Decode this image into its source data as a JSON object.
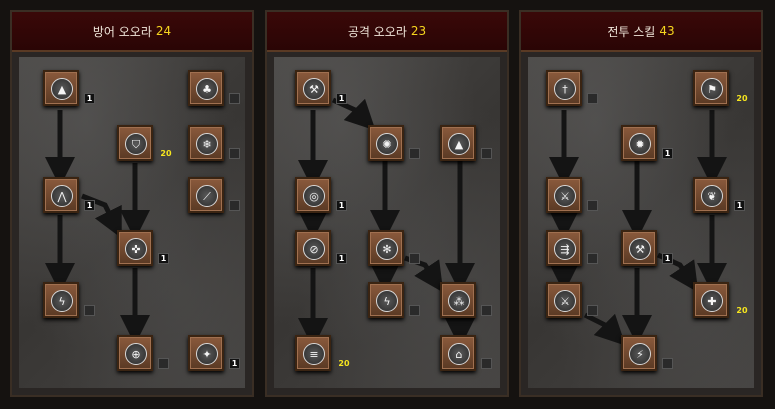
{
  "trees": [
    {
      "title": "방어 오오라",
      "points": "24"
    },
    {
      "title": "공격 오오라",
      "points": "23"
    },
    {
      "title": "전투 스킬",
      "points": "43"
    }
  ],
  "skills": {
    "t1": [
      {
        "icon": "mountain-icon",
        "glyph": "▲",
        "level": "1"
      },
      {
        "icon": "tree-icon",
        "glyph": "♣",
        "level": ""
      },
      {
        "icon": "shield-icon",
        "glyph": "⛉",
        "level": "20"
      },
      {
        "icon": "snowflake-icon",
        "glyph": "❄",
        "level": ""
      },
      {
        "icon": "spike-icon",
        "glyph": "⋀",
        "level": "1"
      },
      {
        "icon": "claw-icon",
        "glyph": "⟋",
        "level": ""
      },
      {
        "icon": "heal-icon",
        "glyph": "✜",
        "level": "1"
      },
      {
        "icon": "lightning-icon",
        "glyph": "ϟ",
        "level": ""
      },
      {
        "icon": "compass-icon",
        "glyph": "⊕",
        "level": ""
      },
      {
        "icon": "star-icon",
        "glyph": "✦",
        "level": "1"
      }
    ],
    "t2": [
      {
        "icon": "axe-icon",
        "glyph": "⚒",
        "level": "1"
      },
      {
        "icon": "burst-icon",
        "glyph": "✺",
        "level": ""
      },
      {
        "icon": "bell-icon",
        "glyph": "▲",
        "level": ""
      },
      {
        "icon": "target-icon",
        "glyph": "◎",
        "level": "1"
      },
      {
        "icon": "slash-icon",
        "glyph": "⊘",
        "level": "1"
      },
      {
        "icon": "wheel-icon",
        "glyph": "✻",
        "level": ""
      },
      {
        "icon": "lightning-icon",
        "glyph": "ϟ",
        "level": ""
      },
      {
        "icon": "trinity-icon",
        "glyph": "⁂",
        "level": ""
      },
      {
        "icon": "stripes-icon",
        "glyph": "≡",
        "level": "20"
      },
      {
        "icon": "tooth-icon",
        "glyph": "⌂",
        "level": ""
      }
    ],
    "t3": [
      {
        "icon": "sword-icon",
        "glyph": "†",
        "level": ""
      },
      {
        "icon": "banner-icon",
        "glyph": "⚑",
        "level": "20"
      },
      {
        "icon": "rage-icon",
        "glyph": "✹",
        "level": "1"
      },
      {
        "icon": "crossed-swords-icon",
        "glyph": "⚔",
        "level": ""
      },
      {
        "icon": "wings-icon",
        "glyph": "❦",
        "level": "1"
      },
      {
        "icon": "charge-icon",
        "glyph": "⇶",
        "level": ""
      },
      {
        "icon": "hammer-icon",
        "glyph": "⚒",
        "level": "1"
      },
      {
        "icon": "crossed-swords-icon",
        "glyph": "⚔",
        "level": ""
      },
      {
        "icon": "cross-shield-icon",
        "glyph": "✚",
        "level": "20"
      },
      {
        "icon": "zeal-icon",
        "glyph": "⚡",
        "level": ""
      }
    ]
  }
}
